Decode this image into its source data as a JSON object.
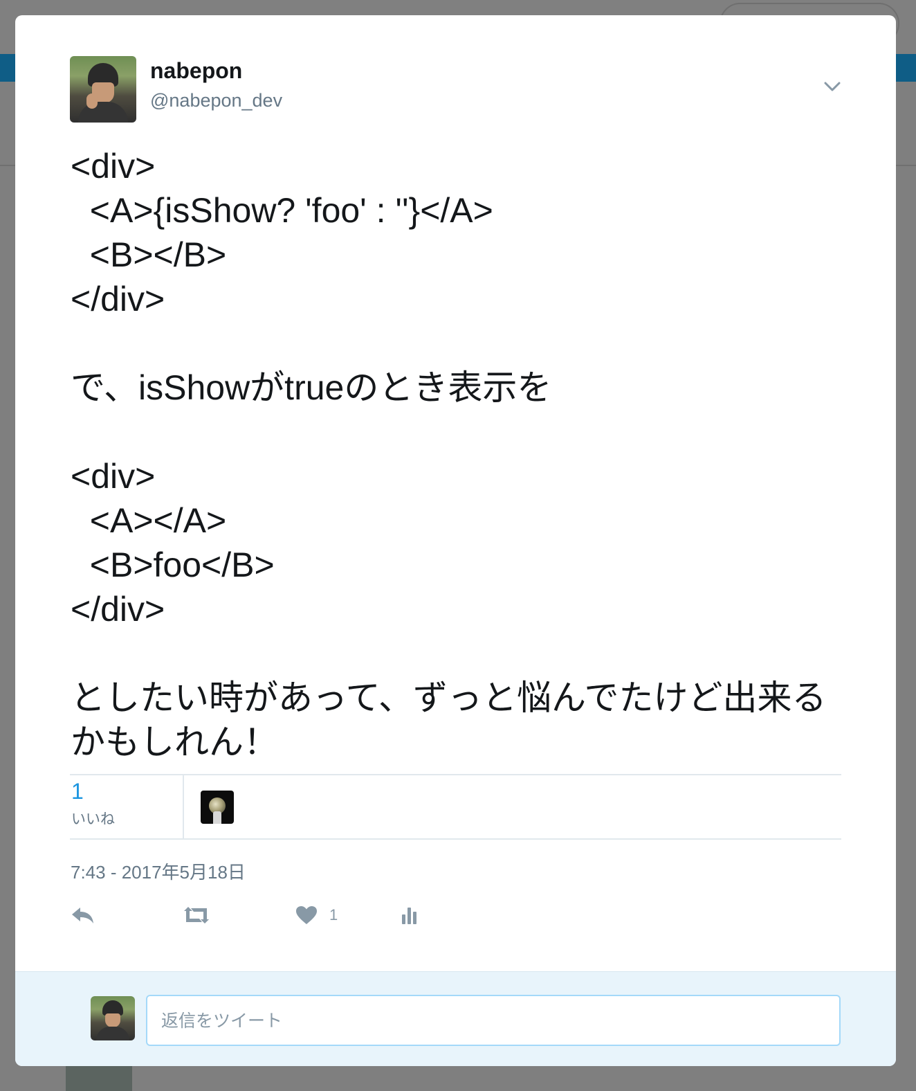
{
  "tweet": {
    "display_name": "nabepon",
    "handle": "@nabepon_dev",
    "text": "<div>\n  <A>{isShow? 'foo' : ''}</A>\n  <B></B>\n</div>\n\nで、isShowがtrueのとき表示を\n\n<div>\n  <A></A>\n  <B>foo</B>\n</div>\n\nとしたい時があって、ずっと悩んでたけど出来るかもしれん！",
    "likes_count": "1",
    "likes_label": "いいね",
    "timestamp": "7:43 - 2017年5月18日",
    "action_like_count": "1"
  },
  "reply": {
    "placeholder": "返信をツイート"
  },
  "icons": {
    "caret": "chevron-down-icon",
    "reply": "reply-icon",
    "retweet": "retweet-icon",
    "like": "heart-icon",
    "analytics": "analytics-icon"
  },
  "colors": {
    "link_blue": "#1b95e0",
    "secondary_text": "#657786",
    "icon_gray": "#8899a6",
    "reply_bg": "#e8f4fb",
    "input_border": "#a4d9f9"
  }
}
